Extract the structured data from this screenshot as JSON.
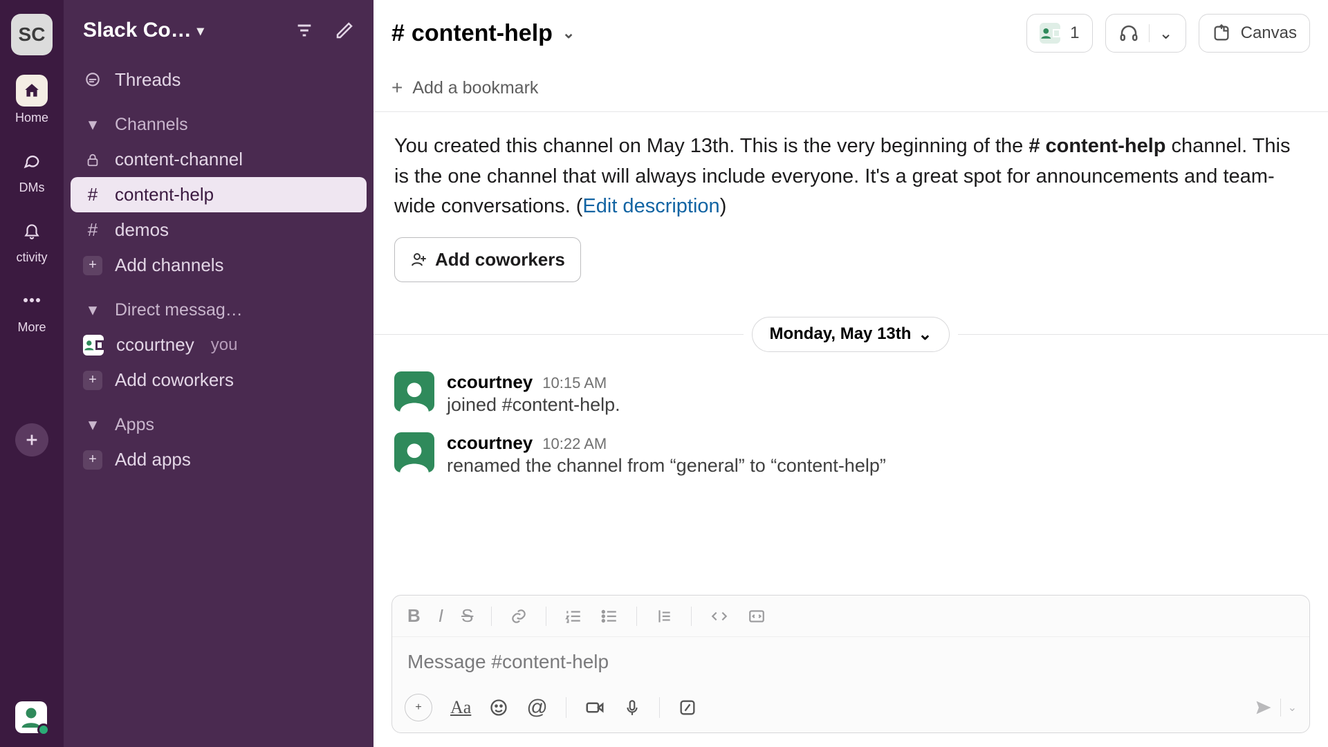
{
  "rail": {
    "workspace_initials": "SC",
    "items": [
      {
        "label": "Home"
      },
      {
        "label": "DMs"
      },
      {
        "label": "ctivity"
      },
      {
        "label": "More"
      }
    ]
  },
  "sidebar": {
    "workspace_name": "Slack Co…",
    "threads_label": "Threads",
    "channels_header": "Channels",
    "channels": [
      {
        "name": "content-channel",
        "private": true,
        "selected": false
      },
      {
        "name": "content-help",
        "private": false,
        "selected": true
      },
      {
        "name": "demos",
        "private": false,
        "selected": false
      }
    ],
    "add_channels": "Add channels",
    "dm_header": "Direct messag…",
    "dms": [
      {
        "name": "ccourtney",
        "you": true
      }
    ],
    "you_label": "you",
    "add_coworkers": "Add coworkers",
    "apps_header": "Apps",
    "add_apps": "Add apps"
  },
  "header": {
    "channel_hash": "#",
    "channel_name": "content-help",
    "member_count": "1",
    "canvas_label": "Canvas"
  },
  "bookmark": {
    "label": "Add a bookmark"
  },
  "intro": {
    "pre": "You created this channel on May 13th. This is the very beginning of the ",
    "chname": "# content-help",
    "post": " channel. This is the one channel that will always include everyone. It's a great spot for announcements and team-wide conversations. (",
    "link": "Edit description",
    "end": ")"
  },
  "add_coworkers_btn": "Add coworkers",
  "date_label": "Monday, May 13th",
  "messages": [
    {
      "user": "ccourtney",
      "time": "10:15 AM",
      "text": "joined #content-help."
    },
    {
      "user": "ccourtney",
      "time": "10:22 AM",
      "text": "renamed the channel from “general” to “content-help”"
    }
  ],
  "composer": {
    "placeholder": "Message #content-help"
  }
}
